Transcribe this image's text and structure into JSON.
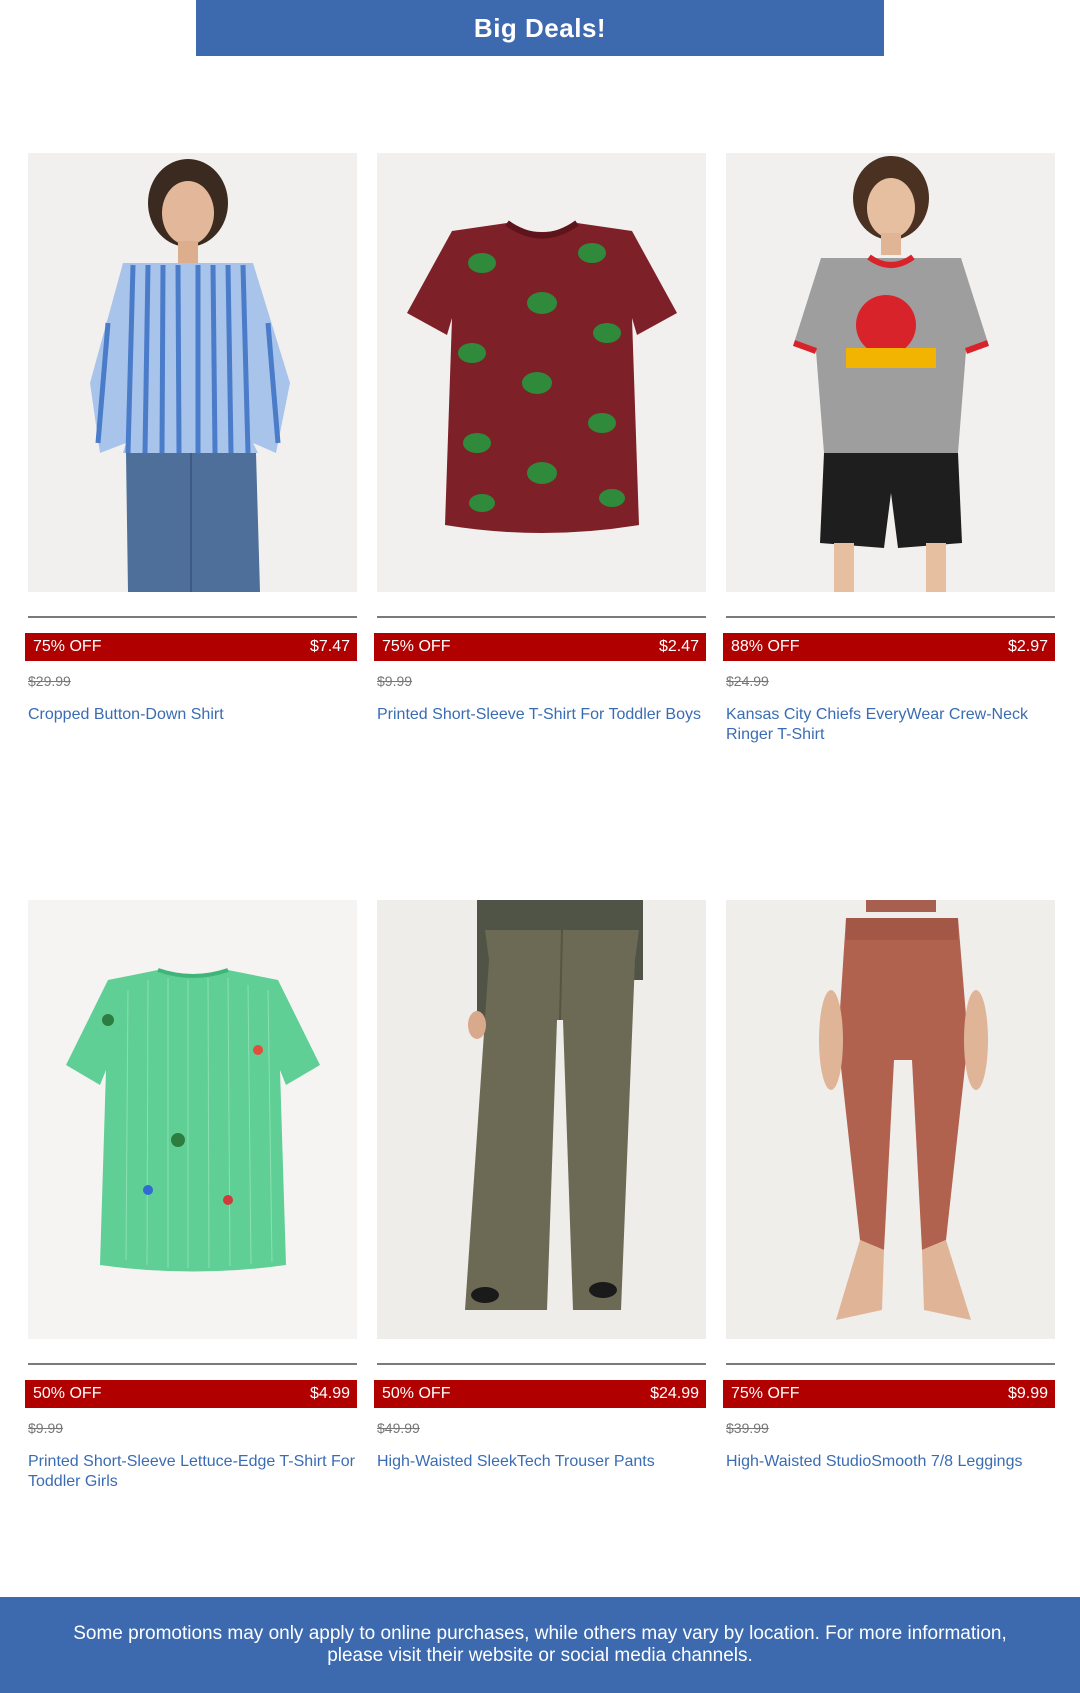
{
  "banner": {
    "title": "Big Deals!"
  },
  "products": [
    {
      "discount": "75% OFF",
      "price": "$7.47",
      "original_price": "$29.99",
      "name": "Cropped Button-Down Shirt",
      "image": "woman-striped-shirt-jeans"
    },
    {
      "discount": "75% OFF",
      "price": "$2.47",
      "original_price": "$9.99",
      "name": "Printed Short-Sleeve T-Shirt For Toddler Boys",
      "image": "maroon-dino-print-tshirt"
    },
    {
      "discount": "88% OFF",
      "price": "$2.97",
      "original_price": "$24.99",
      "name": "Kansas City Chiefs EveryWear Crew-Neck Ringer T-Shirt",
      "image": "woman-chiefs-ringer-tee"
    },
    {
      "discount": "50% OFF",
      "price": "$4.99",
      "original_price": "$9.99",
      "name": "Printed Short-Sleeve Lettuce-Edge T-Shirt For Toddler Girls",
      "image": "green-lettuce-edge-tee"
    },
    {
      "discount": "50% OFF",
      "price": "$24.99",
      "original_price": "$49.99",
      "name": "High-Waisted SleekTech Trouser Pants",
      "image": "olive-trouser-pants"
    },
    {
      "discount": "75% OFF",
      "price": "$9.99",
      "original_price": "$39.99",
      "name": "High-Waisted StudioSmooth 7/8 Leggings",
      "image": "rust-leggings"
    }
  ],
  "footer": {
    "disclaimer": "Some promotions may only apply to online purchases, while others may vary by location. For more information, please visit their website or social media channels."
  },
  "colors": {
    "brand_blue": "#3d6aaf",
    "deal_red": "#b10000",
    "link_blue": "#3a6cb3"
  }
}
